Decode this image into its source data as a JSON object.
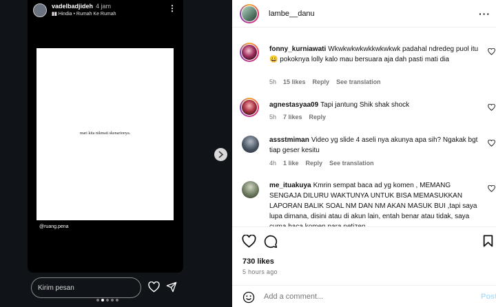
{
  "story": {
    "username": "vadelbadjideh",
    "time": "4 jam",
    "music": "Hindia • Rumah Ke Rumah",
    "music_icon": "music-bars-icon",
    "page_text": "mari kita nikmati skenarionya.",
    "credit": "@ruang.pena",
    "reply_placeholder": "Kirim pesan",
    "page_count": 5,
    "active_page": 1
  },
  "post": {
    "username": "lambe__danu",
    "comments": [
      {
        "username": "fonny_kurniawati",
        "text": "Wkwkwkwkwkkwkwkwk padahal ndredeg puol itu 😀 pokoknya lolly kalo mau bersuara aja dah pasti mati dia",
        "time": "5h",
        "likes": "15 likes",
        "reply": "Reply",
        "translate": "See translation"
      },
      {
        "username": "agnestasyaa09",
        "text": "Tapi jantung Shik shak shock",
        "time": "5h",
        "likes": "7 likes",
        "reply": "Reply"
      },
      {
        "username": "assstmiman",
        "text": "Video yg slide 4 aseli nya akunya apa sih? Ngakak bgt tiap geser kesitu",
        "time": "4h",
        "likes": "1 like",
        "reply": "Reply",
        "translate": "See translation"
      },
      {
        "username": "me_ituakuya",
        "text": "Kmrin sempat baca ad yg komen , MEMANG SENGAJA DILURU WAKTUNYA UNTUK BISA MEMASUKKAN LAPORAN BALIK SOAL NM DAN NM AKAN MASUK BUI ,tapi saya lupa dimana, disini atau di akun lain, entah benar atau tidak, saya cuma baca komen para netizen"
      }
    ],
    "likes": "730 likes",
    "time_ago": "5 hours ago",
    "add_comment_placeholder": "Add a comment...",
    "post_label": "Post"
  },
  "colors": {
    "left_bg": "#101418",
    "post_button": "#b2dffc",
    "meta_text": "#737373"
  }
}
